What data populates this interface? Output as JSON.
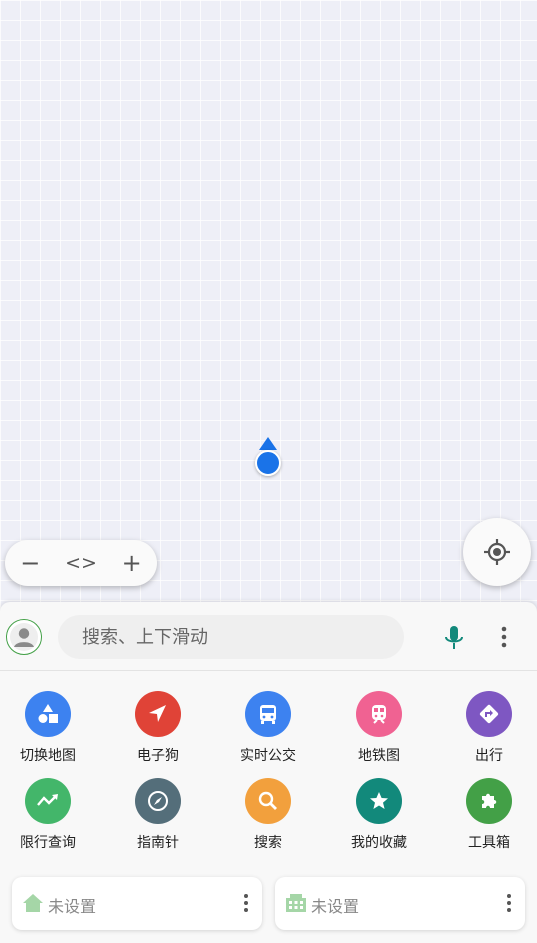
{
  "map": {
    "zoom_out_label": "−",
    "code_label": "<>",
    "zoom_in_label": "+"
  },
  "search": {
    "placeholder": "搜索、上下滑动"
  },
  "tools": [
    {
      "label": "切换地图",
      "color": "#3d82f0",
      "icon": "shapes-icon"
    },
    {
      "label": "电子狗",
      "color": "#e04337",
      "icon": "navigation-arrow-icon"
    },
    {
      "label": "实时公交",
      "color": "#3d82f0",
      "icon": "bus-icon"
    },
    {
      "label": "地铁图",
      "color": "#f06292",
      "icon": "subway-icon"
    },
    {
      "label": "出行",
      "color": "#7e57c2",
      "icon": "directions-icon"
    },
    {
      "label": "限行查询",
      "color": "#43b66a",
      "icon": "trend-icon"
    },
    {
      "label": "指南针",
      "color": "#546e7a",
      "icon": "compass-icon"
    },
    {
      "label": "搜索",
      "color": "#f2a03d",
      "icon": "search-icon"
    },
    {
      "label": "我的收藏",
      "color": "#12897b",
      "icon": "star-icon"
    },
    {
      "label": "工具箱",
      "color": "#43a047",
      "icon": "puzzle-icon"
    }
  ],
  "favorites": {
    "home_label": "未设置",
    "work_label": "未设置"
  }
}
